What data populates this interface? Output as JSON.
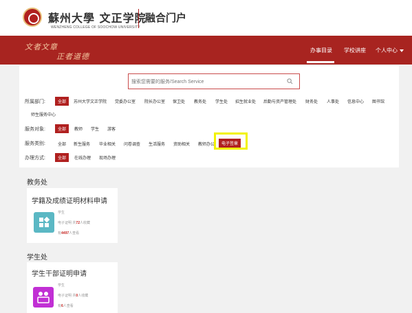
{
  "header": {
    "logo_text": "蘇州大學 文正学院",
    "logo_en": "WENZHENG COLLEGE OF SOOCHOW UNIVERSITY",
    "portal": "融合门户"
  },
  "banner": {
    "motto_line1": "文者文章",
    "motto_line2": "正者道德"
  },
  "nav": {
    "items": [
      "办事目录",
      "学校讲座",
      "个人中心"
    ],
    "active": "办事目录"
  },
  "search": {
    "placeholder": "搜索您需要的服务/Search Service"
  },
  "filters": {
    "dept_label": "所属部门:",
    "dept_options": [
      "全部",
      "苏州大学文正学院",
      "党委办公室",
      "院长办公室",
      "保卫处",
      "教务处",
      "学生处",
      "招生就业处",
      "后勤与资产管理处",
      "财务处",
      "人事处",
      "信息中心",
      "图书馆",
      "师生服务中心"
    ],
    "target_label": "服务对象:",
    "target_options": [
      "全部",
      "教师",
      "学生",
      "游客"
    ],
    "category_label": "服务类别:",
    "category_options": [
      "全部",
      "新生服务",
      "毕业相关",
      "问卷调查",
      "生活服务",
      "资助相关",
      "教师办公",
      "电子签章"
    ],
    "mode_label": "办理方式:",
    "mode_options": [
      "全部",
      "在线办理",
      "现场办理"
    ]
  },
  "sections": [
    {
      "title": "教务处",
      "card": {
        "title": "学籍及成绩证明材料申请",
        "audience": "学生",
        "type": "电子证明",
        "favorites_prefix": "共",
        "favorites": "72",
        "favorites_suffix": "人收藏",
        "views_prefix": "有",
        "views": "4497",
        "views_suffix": "人查看",
        "icon": "document-grid-icon",
        "icon_color": "#5bb8c4"
      }
    },
    {
      "title": "学生处",
      "card": {
        "title": "学生干部证明申请",
        "audience": "学生",
        "type": "电子证明",
        "favorites_prefix": "共",
        "favorites": "0",
        "favorites_suffix": "人收藏",
        "views_prefix": "有",
        "views": "6",
        "views_suffix": "人查看",
        "icon": "team-icon",
        "icon_color": "#c12fd4"
      }
    }
  ],
  "colors": {
    "brand_red": "#b0201f",
    "highlight": "#f2f200"
  }
}
